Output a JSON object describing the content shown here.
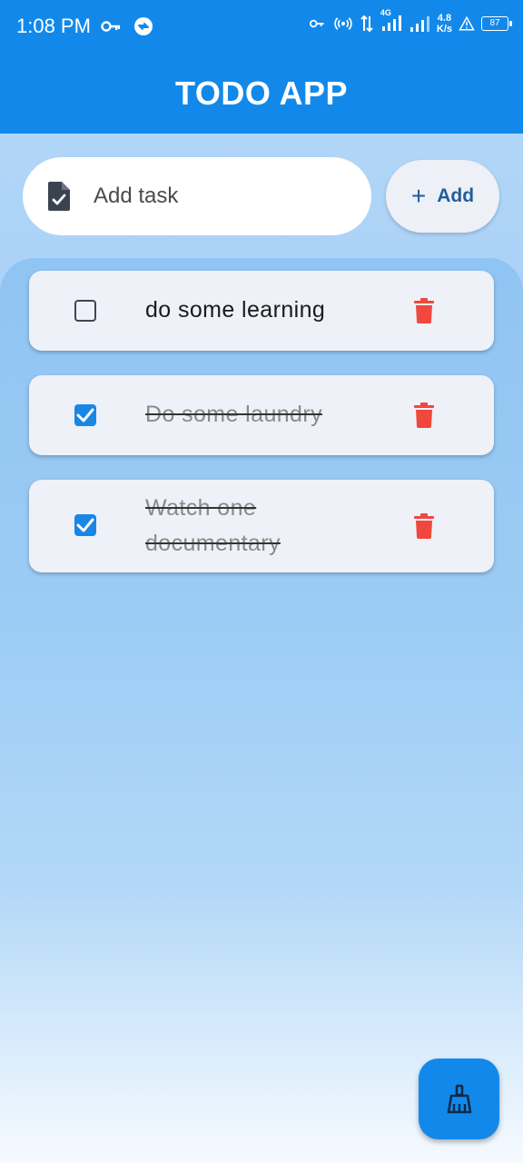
{
  "status_bar": {
    "time": "1:08 PM",
    "network_type": "4G",
    "speed_value": "4.8",
    "speed_unit": "K/s",
    "battery_level": "87"
  },
  "app": {
    "title": "TODO APP"
  },
  "task_input": {
    "placeholder": "Add task",
    "value": "",
    "icon": "task-document-icon"
  },
  "add_button": {
    "label": "Add",
    "icon": "plus-icon"
  },
  "tasks": [
    {
      "text": "do some learning",
      "completed": false
    },
    {
      "text": "Do some laundry",
      "completed": true
    },
    {
      "text": "Watch one documentary",
      "completed": true
    }
  ],
  "fab": {
    "icon": "broom-icon"
  },
  "colors": {
    "primary": "#1289ea",
    "checkbox_checked": "#1a86e6",
    "delete_red": "#f0483e",
    "card_bg": "#eff1f8"
  }
}
